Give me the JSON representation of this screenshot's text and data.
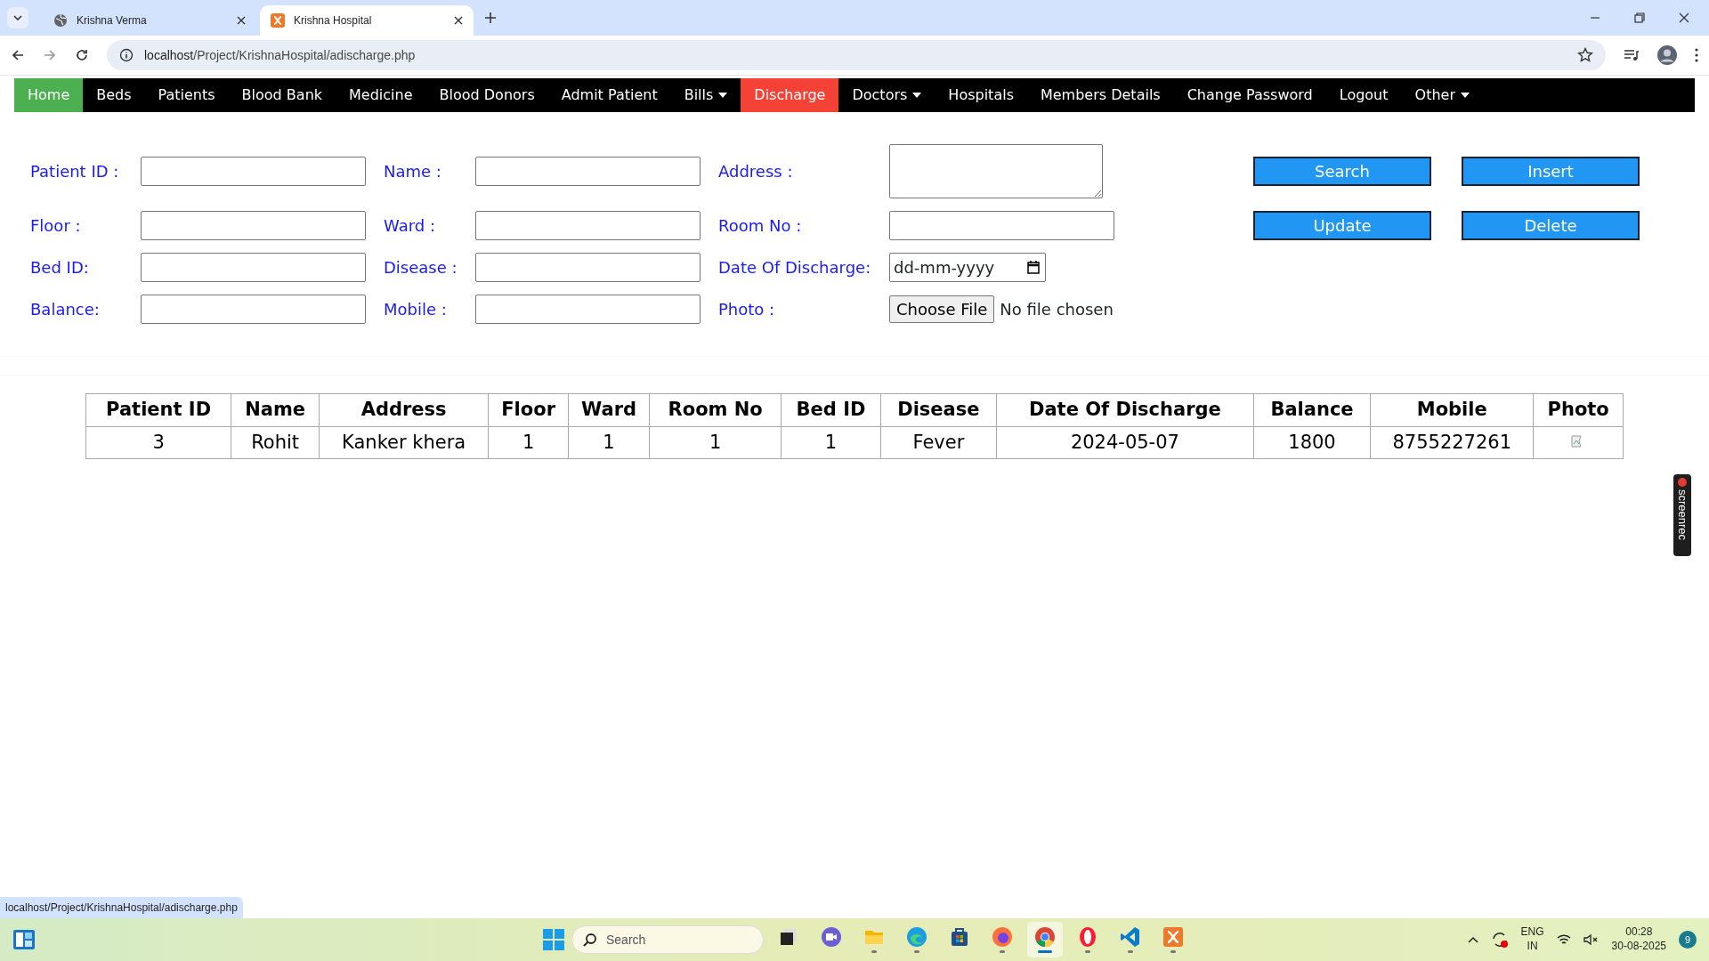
{
  "browser": {
    "tabs": [
      {
        "title": "Krishna Verma",
        "selected": false,
        "kind": "globe"
      },
      {
        "title": "Krishna Hospital",
        "selected": true,
        "kind": "xampp"
      }
    ],
    "url_host": "localhost",
    "url_path": "/Project/KrishnaHospital/adischarge.php",
    "status_url": "localhost/Project/KrishnaHospital/adischarge.php"
  },
  "nav": {
    "items": [
      {
        "label": "Home",
        "color": "#4caf50",
        "dropdown": false
      },
      {
        "label": "Beds",
        "dropdown": false
      },
      {
        "label": "Patients",
        "dropdown": false
      },
      {
        "label": "Blood Bank",
        "dropdown": false
      },
      {
        "label": "Medicine",
        "dropdown": false
      },
      {
        "label": "Blood Donors",
        "dropdown": false
      },
      {
        "label": "Admit Patient",
        "dropdown": false
      },
      {
        "label": "Bills",
        "dropdown": true
      },
      {
        "label": "Discharge",
        "color": "#f44336",
        "dropdown": false
      },
      {
        "label": "Doctors",
        "dropdown": true
      },
      {
        "label": "Hospitals",
        "dropdown": false
      },
      {
        "label": "Members Details",
        "dropdown": false
      },
      {
        "label": "Change Password",
        "dropdown": false
      },
      {
        "label": "Logout",
        "dropdown": false
      },
      {
        "label": "Other",
        "dropdown": true
      }
    ]
  },
  "form": {
    "fields": [
      {
        "label": "Patient ID :",
        "kind": "text"
      },
      {
        "label": "Name :",
        "kind": "text"
      },
      {
        "label": "Address :",
        "kind": "textarea"
      },
      {
        "label": "Floor :",
        "kind": "text"
      },
      {
        "label": "Ward :",
        "kind": "text"
      },
      {
        "label": "Room No :",
        "kind": "text"
      },
      {
        "label": "Bed ID:",
        "kind": "text"
      },
      {
        "label": "Disease :",
        "kind": "text"
      },
      {
        "label": "Date Of Discharge:",
        "kind": "date",
        "placeholder": "dd-mm-yyyy"
      },
      {
        "label": "Balance:",
        "kind": "text"
      },
      {
        "label": "Mobile :",
        "kind": "text"
      },
      {
        "label": "Photo :",
        "kind": "file",
        "button": "Choose File",
        "status": "No file chosen"
      }
    ],
    "buttons": [
      "Search",
      "Insert",
      "Update",
      "Delete"
    ]
  },
  "table": {
    "columns": [
      "Patient ID",
      "Name",
      "Address",
      "Floor",
      "Ward",
      "Room No",
      "Bed ID",
      "Disease",
      "Date Of Discharge",
      "Balance",
      "Mobile",
      "Photo"
    ],
    "rows": [
      [
        "3",
        "Rohit",
        "Kanker khera",
        "1",
        "1",
        "1",
        "1",
        "Fever",
        "2024-05-07",
        "1800",
        "8755227261",
        ""
      ]
    ]
  },
  "overlay_widget": {
    "label": "screenrec"
  },
  "taskbar": {
    "search_placeholder": "Search",
    "apps": [
      {
        "kind": "taskview",
        "running": false
      },
      {
        "kind": "meet",
        "running": false
      },
      {
        "kind": "folder",
        "running": true
      },
      {
        "kind": "edge",
        "running": true
      },
      {
        "kind": "store",
        "running": false
      },
      {
        "kind": "firefox",
        "running": true
      },
      {
        "kind": "chrome",
        "running": true,
        "selected": true
      },
      {
        "kind": "opera",
        "running": true
      },
      {
        "kind": "vscode",
        "running": true
      },
      {
        "kind": "xampp",
        "running": true
      }
    ],
    "language": "ENG",
    "region": "IN",
    "time": "00:28",
    "date": "30-08-2025",
    "notifications": "9"
  }
}
